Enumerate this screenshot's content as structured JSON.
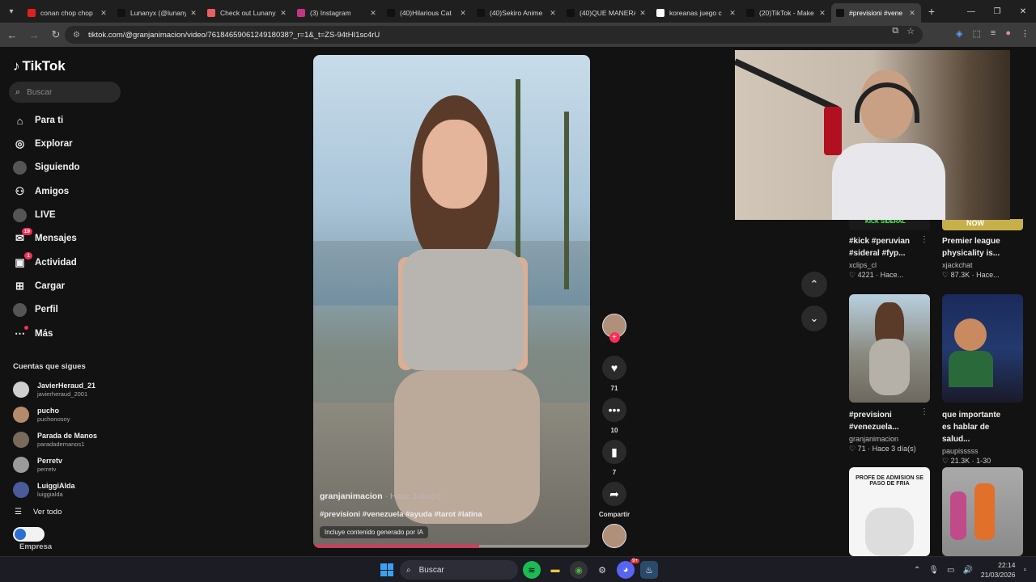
{
  "browser": {
    "tabs": [
      {
        "title": "conan chop chop",
        "favicon_color": "#e02020",
        "favicon": "youtube-icon"
      },
      {
        "title": "Lunanyx (@lunanyx)",
        "favicon_color": "#111111",
        "favicon": "tiktok-icon"
      },
      {
        "title": "Check out Lunanyx",
        "favicon_color": "#e86060",
        "favicon": "app-icon"
      },
      {
        "title": "(3) Instagram",
        "favicon_color": "#c13584",
        "favicon": "instagram-icon"
      },
      {
        "title": "(40)Hilarious Cat",
        "favicon_color": "#111111",
        "favicon": "tiktok-icon"
      },
      {
        "title": "(40)Sekiro Anime",
        "favicon_color": "#111111",
        "favicon": "tiktok-icon"
      },
      {
        "title": "(40)QUE MANERA",
        "favicon_color": "#111111",
        "favicon": "tiktok-icon"
      },
      {
        "title": "koreanas juego c",
        "favicon_color": "#ffffff",
        "favicon": "google-icon"
      },
      {
        "title": "(20)TikTok - Make",
        "favicon_color": "#111111",
        "favicon": "tiktok-icon"
      },
      {
        "title": "#previsioni #vene",
        "favicon_color": "#111111",
        "favicon": "tiktok-icon"
      }
    ],
    "url": "tiktok.com/@granjanimacion/video/7618465906124918038?_r=1&_t=ZS-94tHI1sc4rU"
  },
  "sidebar": {
    "brand": "TikTok",
    "search_placeholder": "Buscar",
    "nav": [
      {
        "label": "Para ti",
        "icon": "home-icon"
      },
      {
        "label": "Explorar",
        "icon": "compass-icon"
      },
      {
        "label": "Siguiendo",
        "icon": "following-avatar-icon"
      },
      {
        "label": "Amigos",
        "icon": "friends-icon"
      },
      {
        "label": "LIVE",
        "icon": "live-avatar-icon"
      },
      {
        "label": "Mensajes",
        "icon": "messages-icon",
        "badge": "19"
      },
      {
        "label": "Actividad",
        "icon": "activity-icon",
        "badge": "1"
      },
      {
        "label": "Cargar",
        "icon": "upload-icon"
      },
      {
        "label": "Perfil",
        "icon": "profile-avatar-icon"
      },
      {
        "label": "Más",
        "icon": "more-icon"
      }
    ],
    "following_title": "Cuentas que sigues",
    "following": [
      {
        "name": "JavierHeraud_21",
        "handle": "javierheraud_2001"
      },
      {
        "name": "pucho",
        "handle": "puchonosoy"
      },
      {
        "name": "Parada de Manos",
        "handle": "paradademanos1"
      },
      {
        "name": "Perretv",
        "handle": "perretv"
      },
      {
        "name": "LuiggiAlda",
        "handle": "luiggialda"
      }
    ],
    "see_all": "Ver todo",
    "company": "Empresa"
  },
  "video": {
    "author": "granjanimacion",
    "time": "· Hace 3 día(s)",
    "hashtags": "#previsioni #venezuela #ayuda  #tarot #latina",
    "ai_label": "Incluye contenido generado por IA",
    "progress": 0.6
  },
  "actions": {
    "likes": "71",
    "comments": "10",
    "saves": "7",
    "share": "Compartir"
  },
  "recommended": [
    {
      "title": "#kick #peruvian #sideral #fyp...",
      "user": "xclips_cl",
      "meta": "♡ 4221 · Hace..."
    },
    {
      "title": "Premier league physicality is...",
      "user": "xjackchat",
      "meta": "♡ 87.3K · Hace..."
    },
    {
      "title": "#previsioni #venezuela...",
      "user": "granjanimacion",
      "meta": "♡ 71 · Hace 3 día(s)"
    },
    {
      "title": "que importante es hablar de salud...",
      "user": "paupisssss",
      "meta": "♡ 21.3K · 1-30"
    }
  ],
  "thumbnails": {
    "top_left_text": "KICK SIDERAL",
    "top_right_text": "NOW",
    "bottom_left_text": "PROFE DE ADMISION SE PASO DE FRIA"
  },
  "taskbar": {
    "search_placeholder": "Buscar",
    "time": "22:14",
    "date": "21/03/2026",
    "discord_badge": "9+"
  }
}
